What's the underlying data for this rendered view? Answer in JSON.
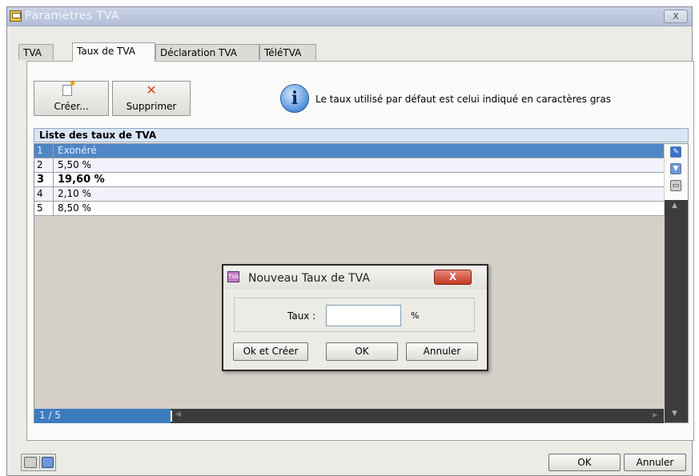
{
  "window": {
    "title": "Paramètres TVA",
    "close_label": "X"
  },
  "tabs": [
    "TVA",
    "Taux de TVA",
    "Déclaration TVA",
    "TéléTVA"
  ],
  "toolbar": {
    "create_label": "Créer...",
    "delete_label": "Supprimer"
  },
  "info": {
    "text": "Le taux utilisé par défaut est celui indiqué en caractères gras"
  },
  "list": {
    "title": "Liste des taux de TVA",
    "rows": [
      {
        "num": "1",
        "value": "Exonéré",
        "selected": true,
        "bold": false
      },
      {
        "num": "2",
        "value": "5,50 %",
        "selected": false,
        "bold": false
      },
      {
        "num": "3",
        "value": "19,60 %",
        "selected": false,
        "bold": true
      },
      {
        "num": "4",
        "value": "2,10 %",
        "selected": false,
        "bold": false
      },
      {
        "num": "5",
        "value": "8,50 %",
        "selected": false,
        "bold": false
      }
    ],
    "counter": "1 / 5"
  },
  "dialog": {
    "title": "Nouveau Taux de TVA",
    "close_label": "X",
    "field_label": "Taux :",
    "field_value": "",
    "unit": "%",
    "btn_ok_create": "Ok et Créer",
    "btn_ok": "OK",
    "btn_cancel": "Annuler"
  },
  "footer": {
    "ok_label": "OK",
    "cancel_label": "Annuler"
  },
  "colors": {
    "selected_row": "#4f86c6",
    "title_bar": "#b4c0d9",
    "dialog_close": "#c23b22"
  }
}
